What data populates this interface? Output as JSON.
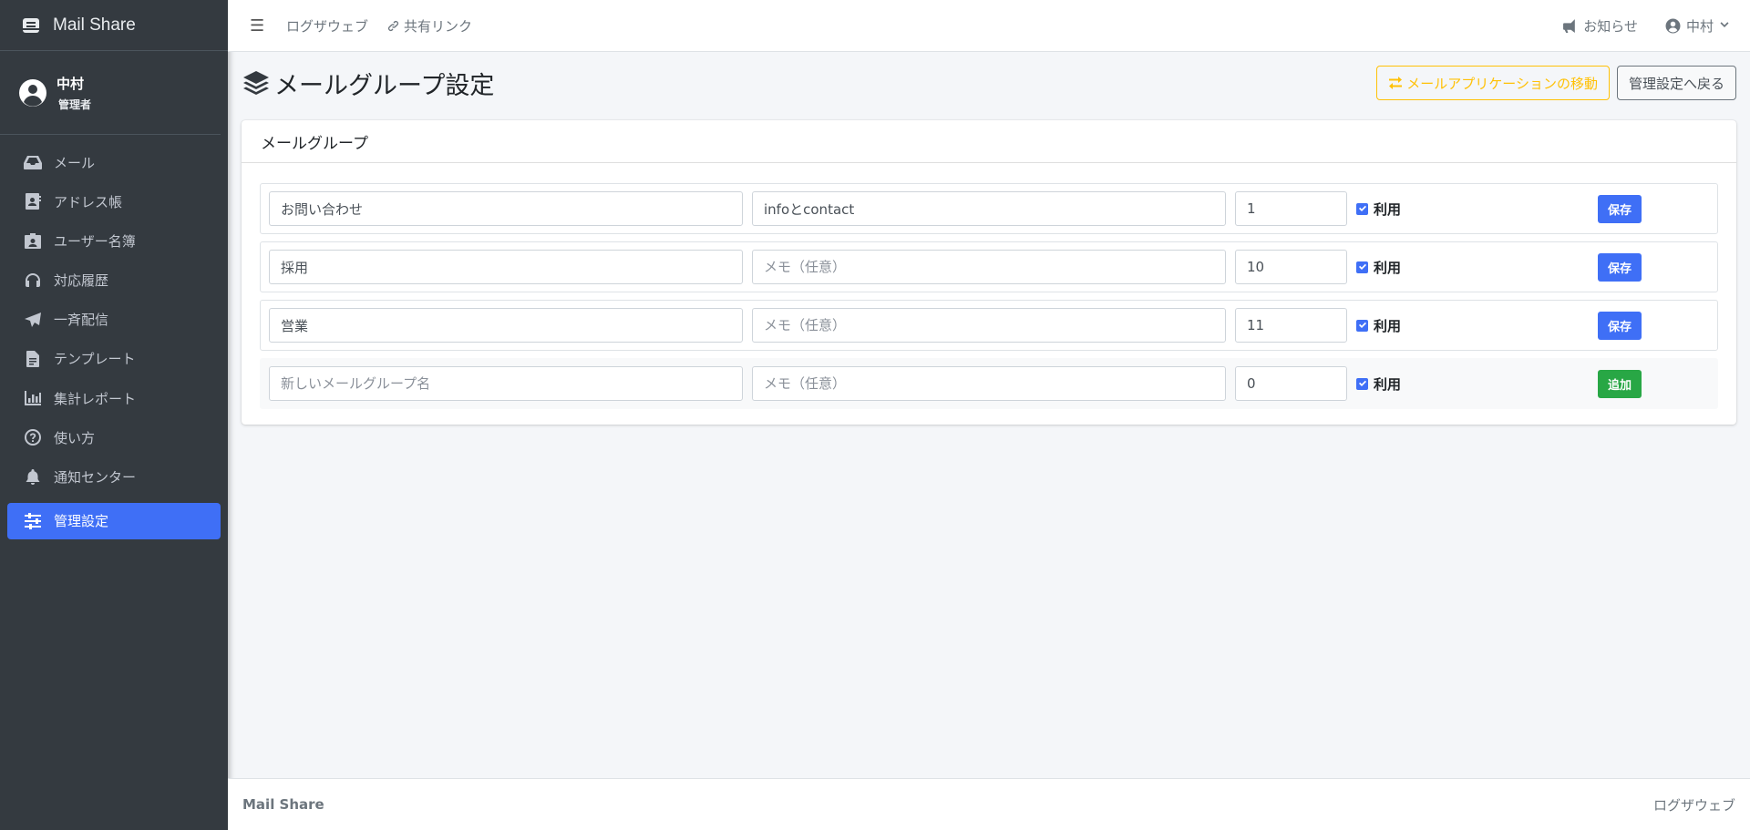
{
  "sidebar": {
    "brand": "Mail Share",
    "user": {
      "name": "中村",
      "role": "管理者"
    },
    "items": [
      {
        "label": "メール",
        "icon": "inbox-icon"
      },
      {
        "label": "アドレス帳",
        "icon": "address-book-icon"
      },
      {
        "label": "ユーザー名簿",
        "icon": "id-badge-icon"
      },
      {
        "label": "対応履歴",
        "icon": "headset-icon"
      },
      {
        "label": "一斉配信",
        "icon": "paper-plane-icon"
      },
      {
        "label": "テンプレート",
        "icon": "file-icon"
      },
      {
        "label": "集計レポート",
        "icon": "chart-icon"
      },
      {
        "label": "使い方",
        "icon": "question-icon"
      },
      {
        "label": "通知センター",
        "icon": "bell-icon"
      },
      {
        "label": "管理設定",
        "icon": "sliders-icon",
        "active": true
      }
    ]
  },
  "topbar": {
    "links": [
      "ログザウェブ",
      "共有リンク"
    ],
    "notice": "お知らせ",
    "user": "中村"
  },
  "header": {
    "title": "メールグループ設定",
    "move_button": "メールアプリケーションの移動",
    "back_button": "管理設定へ戻る"
  },
  "card": {
    "title": "メールグループ",
    "use_label": "利用",
    "memo_placeholder": "メモ（任意）",
    "rows": [
      {
        "name": "お問い合わせ",
        "memo": "infoとcontact",
        "order": "1",
        "button": "保存"
      },
      {
        "name": "採用",
        "memo": "",
        "order": "10",
        "button": "保存"
      },
      {
        "name": "営業",
        "memo": "",
        "order": "11",
        "button": "保存"
      }
    ],
    "new_row": {
      "name_placeholder": "新しいメールグループ名",
      "order": "0",
      "button": "追加"
    }
  },
  "footer": {
    "left": "Mail Share",
    "right": "ログザウェブ"
  },
  "colors": {
    "primary": "#3f6ff6",
    "success": "#28a745",
    "warning": "#ffc107",
    "sidebar": "#343a40"
  }
}
